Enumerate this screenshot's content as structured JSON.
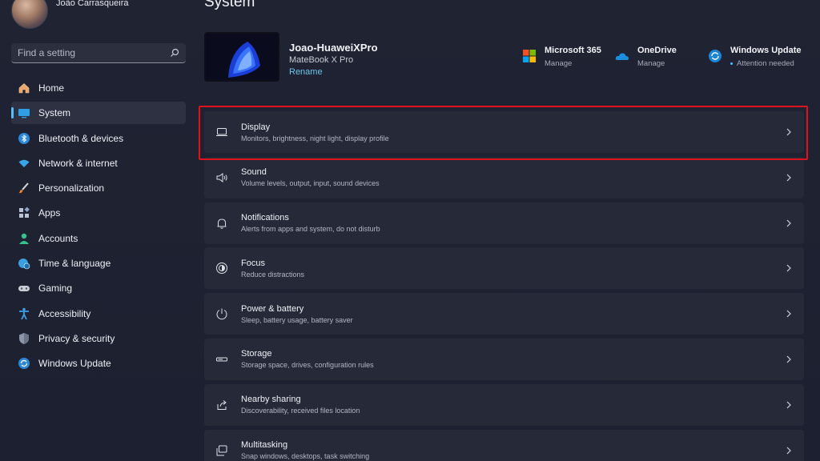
{
  "profile": {
    "name": "João Carrasqueira"
  },
  "search": {
    "placeholder": "Find a setting"
  },
  "nav": {
    "items": [
      {
        "label": "Home"
      },
      {
        "label": "System"
      },
      {
        "label": "Bluetooth & devices"
      },
      {
        "label": "Network & internet"
      },
      {
        "label": "Personalization"
      },
      {
        "label": "Apps"
      },
      {
        "label": "Accounts"
      },
      {
        "label": "Time & language"
      },
      {
        "label": "Gaming"
      },
      {
        "label": "Accessibility"
      },
      {
        "label": "Privacy & security"
      },
      {
        "label": "Windows Update"
      }
    ],
    "active": "System"
  },
  "page": {
    "title": "System"
  },
  "device": {
    "name": "Joao-HuaweiXPro",
    "model": "MateBook X Pro",
    "rename": "Rename"
  },
  "quick": {
    "m365": {
      "title": "Microsoft 365",
      "sub": "Manage"
    },
    "onedrive": {
      "title": "OneDrive",
      "sub": "Manage"
    },
    "update": {
      "title": "Windows Update",
      "sub": "Attention needed"
    }
  },
  "cards": [
    {
      "title": "Display",
      "sub": "Monitors, brightness, night light, display profile"
    },
    {
      "title": "Sound",
      "sub": "Volume levels, output, input, sound devices"
    },
    {
      "title": "Notifications",
      "sub": "Alerts from apps and system, do not disturb"
    },
    {
      "title": "Focus",
      "sub": "Reduce distractions"
    },
    {
      "title": "Power & battery",
      "sub": "Sleep, battery usage, battery saver"
    },
    {
      "title": "Storage",
      "sub": "Storage space, drives, configuration rules"
    },
    {
      "title": "Nearby sharing",
      "sub": "Discoverability, received files location"
    },
    {
      "title": "Multitasking",
      "sub": "Snap windows, desktops, task switching"
    }
  ],
  "colors": {
    "accent": "#4cc2ff",
    "highlight": "#e0121b"
  }
}
